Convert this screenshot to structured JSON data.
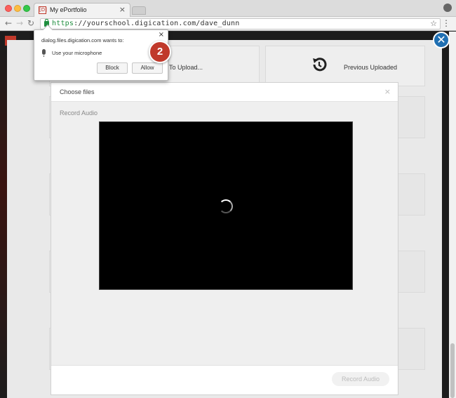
{
  "browser": {
    "tab_title": "My ePortfolio",
    "tab_favicon": "[D]",
    "url_scheme": "https",
    "url_rest": "://yourschool.digication.com/dave_dunn",
    "colors": {
      "secure": "#1e8e3e",
      "accent": "#c0392b"
    }
  },
  "permission_popup": {
    "message": "dialog.files.digication.com wants to:",
    "permission": "Use your microphone",
    "block_label": "Block",
    "allow_label": "Allow",
    "close_glyph": "×"
  },
  "step_badge": "2",
  "uploader": {
    "upload_label": "To Upload...",
    "previous_label": "Previous Uploaded"
  },
  "dialog": {
    "title": "Choose files",
    "subtitle": "Record Audio",
    "close_glyph": "×",
    "record_button": "Record Audio"
  },
  "overlay_close_glyph": "✕"
}
